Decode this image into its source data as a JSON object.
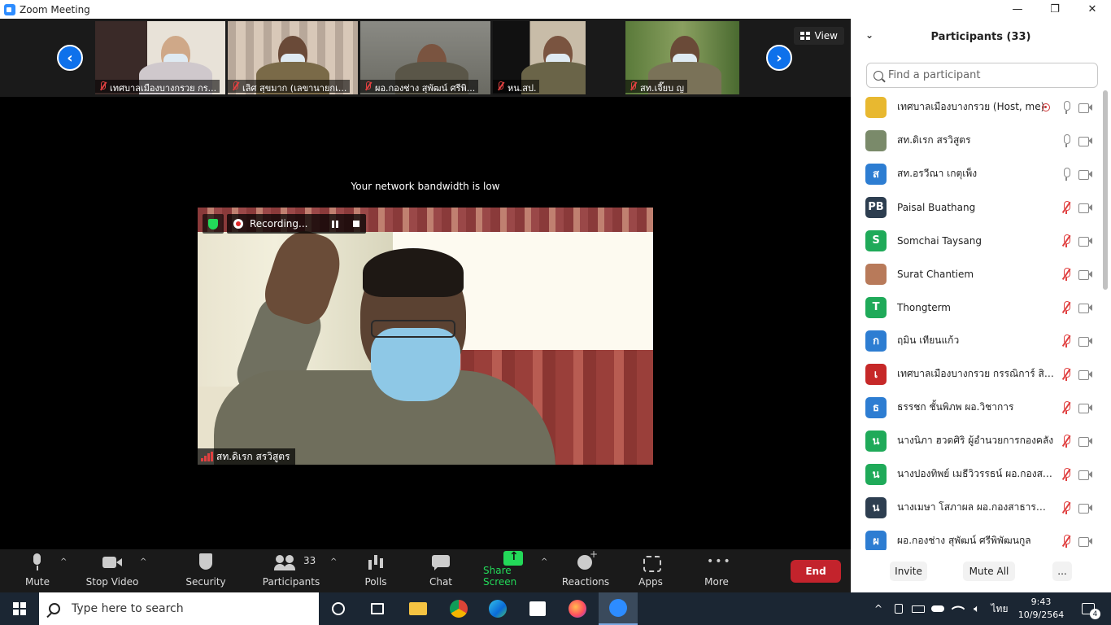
{
  "window": {
    "title": "Zoom Meeting",
    "minimize_glyph": "—",
    "restore_glyph": "❐",
    "close_glyph": "✕"
  },
  "gallery": {
    "thumbnails": [
      {
        "label": "เทศบาลเมืองบางกรวย กร..."
      },
      {
        "label": "เลิศ สุขมาก (เลขานายกเ..."
      },
      {
        "label": "ผอ.กองช่าง สุพัฒน์ ศรีพิ..."
      },
      {
        "label": "หน.สป."
      },
      {
        "label": "สท.เจี๊ยบ ญ"
      }
    ],
    "view_label": "View",
    "prev_glyph": "‹",
    "next_glyph": "›"
  },
  "main_video": {
    "bandwidth_message": "Your network bandwidth is low",
    "recording_label": "Recording...",
    "speaker_name": "สท.ดิเรก สรวิสูตร"
  },
  "toolbar": {
    "mute_label": "Mute",
    "stop_video_label": "Stop Video",
    "security_label": "Security",
    "participants_label": "Participants",
    "participants_count": "33",
    "polls_label": "Polls",
    "chat_label": "Chat",
    "share_screen_label": "Share Screen",
    "reactions_label": "Reactions",
    "apps_label": "Apps",
    "more_label": "More",
    "end_label": "End",
    "caret_glyph": "^"
  },
  "participants_panel": {
    "title": "Participants (33)",
    "collapse_glyph": "⌄",
    "search_placeholder": "Find a participant",
    "participants": [
      {
        "name": "เทศบาลเมืองบางกรวย (Host, me)",
        "initial": "",
        "avatar_color": "#e8b830",
        "muted": false,
        "recording": true
      },
      {
        "name": "สท.ดิเรก สรวิสูตร",
        "initial": "",
        "avatar_color": "#7a8a6a",
        "muted": false,
        "recording": false
      },
      {
        "name": "สท.อรวีณา เกตุเพ็ง",
        "initial": "ส",
        "avatar_color": "#2d7dd2",
        "muted": false,
        "recording": false
      },
      {
        "name": "Paisal Buathang",
        "initial": "PB",
        "avatar_color": "#2d3e50",
        "muted": true,
        "recording": false
      },
      {
        "name": "Somchai Taysang",
        "initial": "S",
        "avatar_color": "#1faa59",
        "muted": true,
        "recording": false
      },
      {
        "name": "Surat Chantiem",
        "initial": "",
        "avatar_color": "#b87a5a",
        "muted": true,
        "recording": false
      },
      {
        "name": "Thongterm",
        "initial": "T",
        "avatar_color": "#1faa59",
        "muted": true,
        "recording": false
      },
      {
        "name": "ฤมิน เทียนแก้ว",
        "initial": "ก",
        "avatar_color": "#2d7dd2",
        "muted": true,
        "recording": false
      },
      {
        "name": "เทศบาลเมืองบางกรวย กรรณิการ์ สิท...",
        "initial": "เ",
        "avatar_color": "#c62828",
        "muted": true,
        "recording": false
      },
      {
        "name": "ธรรชก ชั้นพิภพ ผอ.วิชาการ",
        "initial": "ธ",
        "avatar_color": "#2d7dd2",
        "muted": true,
        "recording": false
      },
      {
        "name": "นางนิภา ฮวดศิริ  ผู้อำนวยการกองคลัง",
        "initial": "น",
        "avatar_color": "#1faa59",
        "muted": true,
        "recording": false
      },
      {
        "name": "นางปองทิพย์ เมธีวิวรรธน์ ผอ.กองสวัส...",
        "initial": "น",
        "avatar_color": "#1faa59",
        "muted": true,
        "recording": false
      },
      {
        "name": "นางเมษา  โสภาผล ผอ.กองสาธารณสุ...",
        "initial": "น",
        "avatar_color": "#2d3e50",
        "muted": true,
        "recording": false
      },
      {
        "name": "ผอ.กองช่าง สุพัฒน์ ศรีพิพัฒนกูล",
        "initial": "ผ",
        "avatar_color": "#2d7dd2",
        "muted": true,
        "recording": false
      }
    ],
    "invite_label": "Invite",
    "mute_all_label": "Mute All",
    "more_label": "..."
  },
  "taskbar": {
    "search_placeholder": "Type here to search",
    "language": "ไทย",
    "time": "9:43",
    "date": "10/9/2564",
    "notification_count": "4"
  }
}
